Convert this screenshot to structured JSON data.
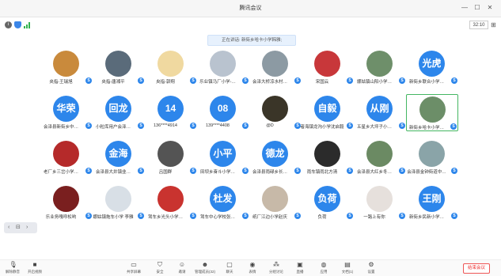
{
  "window": {
    "title": "腾讯会议"
  },
  "info": {
    "time": "32:10"
  },
  "speaking": "正在讲话: 新街乡哈卡小学韩雅;",
  "icons": {
    "info": "i",
    "grid": "⊞",
    "close": "✕",
    "minimize": "—",
    "maximize": "☐"
  },
  "colors": {
    "avatar_blue": "#2d86eb",
    "selected_border": "#44b662",
    "end_red": "#e33333"
  },
  "participants": [
    {
      "name": "央指-王瑞旭",
      "avatar_text": "",
      "avatar_color": "#c98a3c"
    },
    {
      "name": "央指-唐湘平",
      "avatar_text": "",
      "avatar_color": "#5a6b7a"
    },
    {
      "name": "央指-郭翔",
      "avatar_text": "",
      "avatar_color": "#f0d9a0"
    },
    {
      "name": "乐业镇马厂小学-…",
      "avatar_text": "",
      "avatar_color": "#b9c3cf"
    },
    {
      "name": "会泽大桥凉水村…",
      "avatar_text": "",
      "avatar_color": "#8c9aa3"
    },
    {
      "name": "宋国云",
      "avatar_text": "",
      "avatar_color": "#c8373a"
    },
    {
      "name": "娜姑镇山阳小学…",
      "avatar_text": "",
      "avatar_color": "#6e8f6a"
    },
    {
      "name": "新街乡联合小学…",
      "avatar_text": "光虎",
      "avatar_color": "#2d86eb"
    },
    {
      "name": "会泽县新街乡中…",
      "avatar_text": "华荣",
      "avatar_color": "#2d86eb"
    },
    {
      "name": "小粒库用户会泽…",
      "avatar_text": "回龙",
      "avatar_color": "#2d86eb"
    },
    {
      "name": "136****4914",
      "avatar_text": "14",
      "avatar_color": "#2d86eb"
    },
    {
      "name": "139****4408",
      "avatar_text": "08",
      "avatar_color": "#2d86eb"
    },
    {
      "name": "@D",
      "avatar_text": "",
      "avatar_color": "#3a3528"
    },
    {
      "name": "者海镇龙沟小学沈启毅",
      "avatar_text": "自毅",
      "avatar_color": "#2d86eb"
    },
    {
      "name": "五星乡大坪子小…",
      "avatar_text": "从刚",
      "avatar_color": "#2d86eb"
    },
    {
      "name": "新街乡哈卡小学…",
      "avatar_text": "",
      "avatar_color": "#6c8e68"
    },
    {
      "name": "老厂乡三岔小学…",
      "avatar_text": "",
      "avatar_color": "#b52a2a"
    },
    {
      "name": "会泽县大井镇韭…",
      "avatar_text": "金海",
      "avatar_color": "#2d86eb"
    },
    {
      "name": "吕国群",
      "avatar_text": "",
      "avatar_color": "#545454"
    },
    {
      "name": "田坝乡奋斗小学…",
      "avatar_text": "小平",
      "avatar_color": "#2d86eb"
    },
    {
      "name": "会泽县雨碌乡长…",
      "avatar_text": "德龙",
      "avatar_color": "#2d86eb"
    },
    {
      "name": "雨车镇雨北方清",
      "avatar_text": "",
      "avatar_color": "#2b2b2b"
    },
    {
      "name": "会泽县大红乡冬…",
      "avatar_text": "",
      "avatar_color": "#6b8a63"
    },
    {
      "name": "会泽县金钟街道中…",
      "avatar_text": "",
      "avatar_color": "#8aa4a8"
    },
    {
      "name": "乐业务嘎呼松哟",
      "avatar_text": "",
      "avatar_color": "#7a1f1f"
    },
    {
      "name": "娜姑镇拖车小学 李雅",
      "avatar_text": "",
      "avatar_color": "#d8dfe6"
    },
    {
      "name": "驾车乡光头小学…",
      "avatar_text": "",
      "avatar_color": "#c9332f"
    },
    {
      "name": "驾车中心学校张…",
      "avatar_text": "杜发",
      "avatar_color": "#2d86eb"
    },
    {
      "name": "纸厂江边小学赵庆",
      "avatar_text": "",
      "avatar_color": "#c7b9a8"
    },
    {
      "name": "负荷",
      "avatar_text": "负荷",
      "avatar_color": "#2d86eb"
    },
    {
      "name": "一路上有你",
      "avatar_text": "",
      "avatar_color": "#e6e0dc"
    },
    {
      "name": "新街乡民新小学…",
      "avatar_text": "王刚",
      "avatar_color": "#2d86eb"
    }
  ],
  "selected_index": 15,
  "toolbar": {
    "items": [
      {
        "label": "解除静音",
        "icon": "🎙"
      },
      {
        "label": "开启视频",
        "icon": "■"
      },
      {
        "label": "共享屏幕",
        "icon": "▭"
      },
      {
        "label": "安全",
        "icon": "⛉"
      },
      {
        "label": "邀请",
        "icon": "☺"
      },
      {
        "label": "管理成员(32)",
        "icon": "☻"
      },
      {
        "label": "聊天",
        "icon": "▢"
      },
      {
        "label": "表情",
        "icon": "◉"
      },
      {
        "label": "分组讨论",
        "icon": "⁂"
      },
      {
        "label": "直播",
        "icon": "▣"
      },
      {
        "label": "应用",
        "icon": "◍"
      },
      {
        "label": "文档(1)",
        "icon": "▤"
      },
      {
        "label": "设置",
        "icon": "⚙"
      }
    ],
    "end_label": "结束会议"
  }
}
